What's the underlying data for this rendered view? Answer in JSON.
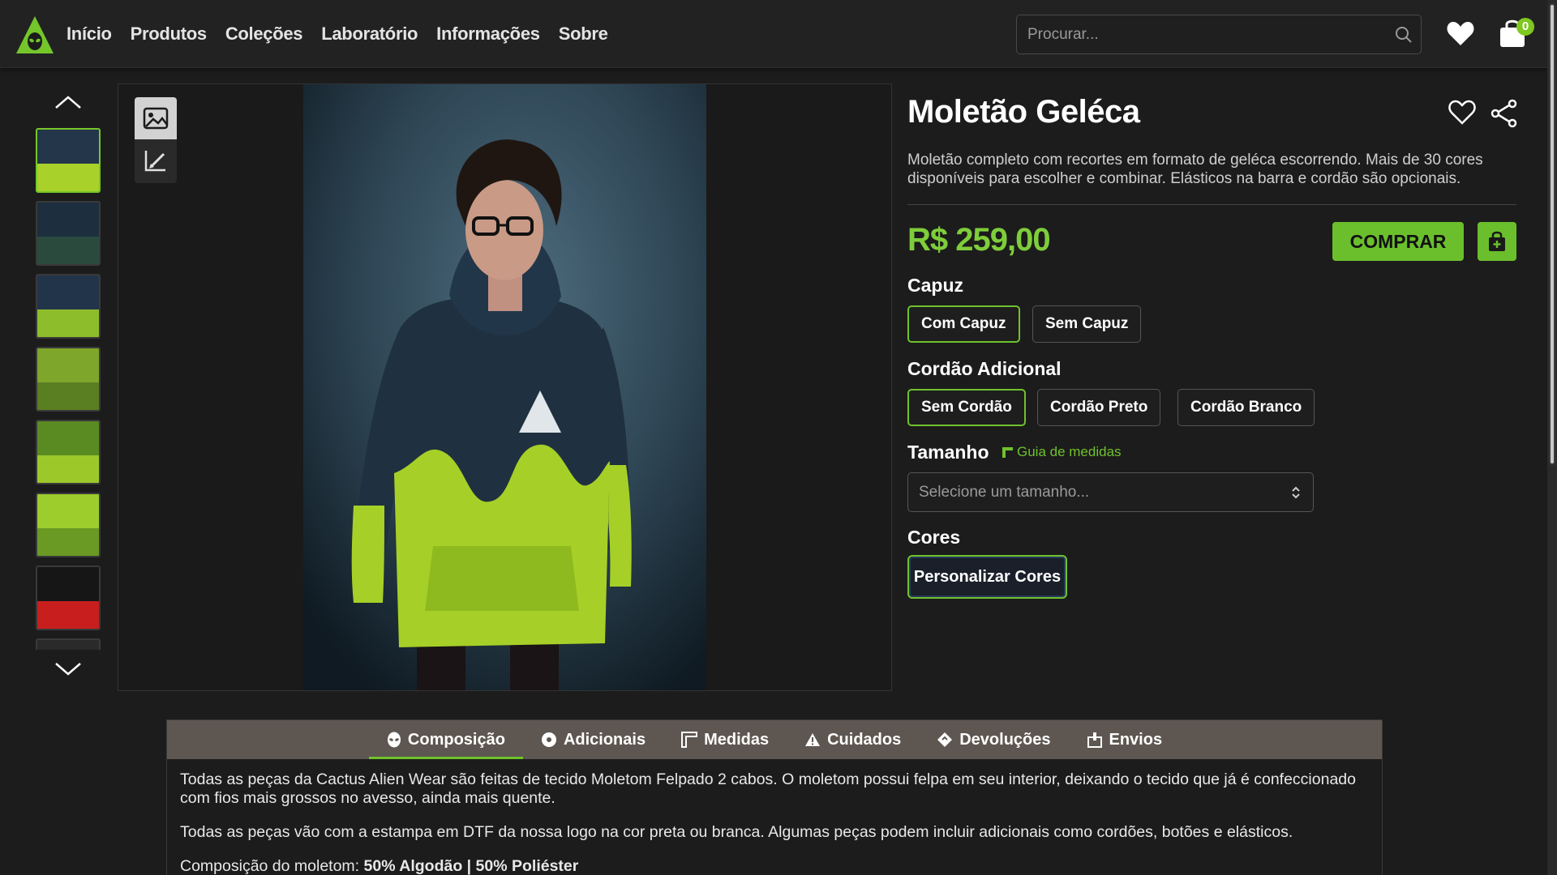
{
  "nav": {
    "links": [
      "Início",
      "Produtos",
      "Coleções",
      "Laboratório",
      "Informações",
      "Sobre"
    ],
    "search_placeholder": "Procurar...",
    "cart_count": "0"
  },
  "product": {
    "title": "Moletão Geléca",
    "description": "Moletão completo com recortes em formato de geléca escorrendo. Mais de 30 cores disponíveis para escolher e combinar. Elásticos na barra e cordão são opcionais.",
    "price": "R$ 259,00",
    "buy_label": "COMPRAR"
  },
  "options": {
    "capuz": {
      "label": "Capuz",
      "items": [
        "Com Capuz",
        "Sem Capuz"
      ],
      "selected": "Com Capuz"
    },
    "cordao": {
      "label": "Cordão Adicional",
      "items": [
        "Sem Cordão",
        "Cordão Preto",
        "Cordão Branco"
      ],
      "selected": "Sem Cordão"
    },
    "tamanho": {
      "label": "Tamanho",
      "guide": "Guia de medidas",
      "placeholder": "Selecione um tamanho..."
    },
    "cores": {
      "label": "Cores",
      "button": "Personalizar Cores"
    }
  },
  "tabs": [
    "Composição",
    "Adicionais",
    "Medidas",
    "Cuidados",
    "Devoluções",
    "Envios"
  ],
  "composicao": {
    "p1": "Todas as peças da Cactus Alien Wear são feitas de tecido Moletom Felpado 2 cabos. O moletom possui felpa em seu interior, deixando o tecido que já é confeccionado com fios mais grossos no avesso, ainda mais quente.",
    "p2": "Todas as peças vão com a estampa em DTF da nossa logo na cor preta ou branca. Algumas peças podem incluir adicionais como cordões, botões e elásticos.",
    "p3_label": "Composição do moletom: ",
    "p3_value": "50% Algodão | 50% Poliéster"
  },
  "colors": {
    "accent": "#6fc22c",
    "price": "#7ecd3a",
    "tab_bar": "#5e5751",
    "background": "#1c1c1c"
  }
}
